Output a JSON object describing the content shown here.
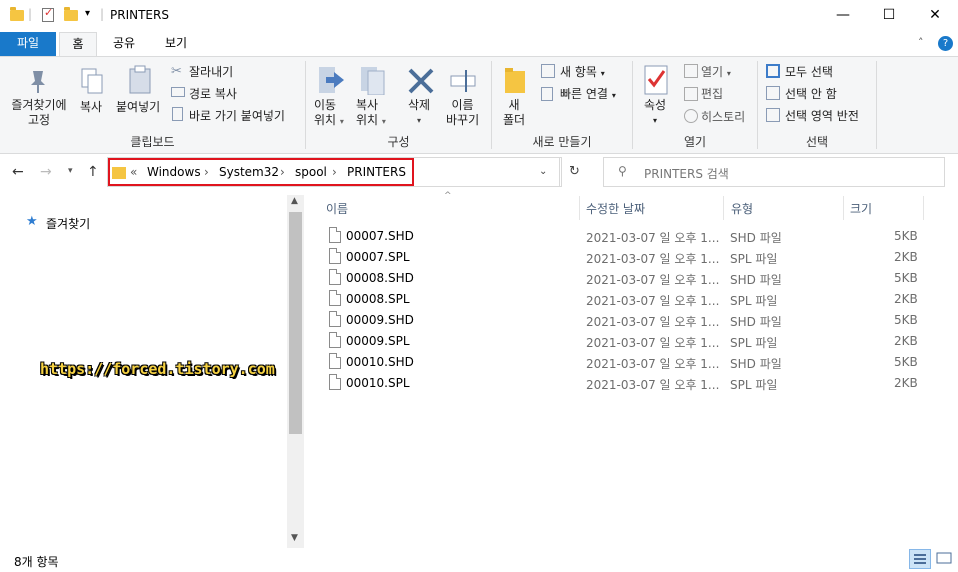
{
  "window": {
    "title": "PRINTERS",
    "qa_sep": "|",
    "qa_dropdown": "▾",
    "min": "—",
    "max": "☐",
    "close": "✕"
  },
  "tabs": [
    "파일",
    "홈",
    "공유",
    "보기"
  ],
  "ribbon": {
    "pin": [
      "즐겨찾기에",
      "고정"
    ],
    "copy": "복사",
    "paste": "붙여넣기",
    "cut": "잘라내기",
    "copy_path": "경로 복사",
    "paste_shortcut": "바로 가기 붙여넣기",
    "group_clipboard": "클립보드",
    "move_to": [
      "이동",
      "위치"
    ],
    "copy_to": [
      "복사",
      "위치"
    ],
    "delete": "삭제",
    "rename": [
      "이름",
      "바꾸기"
    ],
    "group_organize": "구성",
    "new_folder": [
      "새",
      "폴더"
    ],
    "new_item": "새 항목",
    "easy_access": "빠른 연결",
    "group_new": "새로 만들기",
    "properties": "속성",
    "open": "열기",
    "edit": "편집",
    "history": "히스토리",
    "group_open": "열기",
    "select_all": "모두 선택",
    "select_none": "선택 안 함",
    "invert_select": "선택 영역 반전",
    "group_select": "선택"
  },
  "address": {
    "prefix": "«",
    "crumbs": [
      "Windows",
      "System32",
      "spool",
      "PRINTERS"
    ],
    "sep": "›",
    "search_placeholder": "PRINTERS 검색"
  },
  "navpane": {
    "quick_access": "즐겨찾기"
  },
  "columns": [
    "이름",
    "수정한 날짜",
    "유형",
    "크기"
  ],
  "files": [
    {
      "name": "00007.SHD",
      "date": "2021-03-07 일 오후 1...",
      "type": "SHD 파일",
      "size": "5KB"
    },
    {
      "name": "00007.SPL",
      "date": "2021-03-07 일 오후 1...",
      "type": "SPL 파일",
      "size": "2KB"
    },
    {
      "name": "00008.SHD",
      "date": "2021-03-07 일 오후 1...",
      "type": "SHD 파일",
      "size": "5KB"
    },
    {
      "name": "00008.SPL",
      "date": "2021-03-07 일 오후 1...",
      "type": "SPL 파일",
      "size": "2KB"
    },
    {
      "name": "00009.SHD",
      "date": "2021-03-07 일 오후 1...",
      "type": "SHD 파일",
      "size": "5KB"
    },
    {
      "name": "00009.SPL",
      "date": "2021-03-07 일 오후 1...",
      "type": "SPL 파일",
      "size": "2KB"
    },
    {
      "name": "00010.SHD",
      "date": "2021-03-07 일 오후 1...",
      "type": "SHD 파일",
      "size": "5KB"
    },
    {
      "name": "00010.SPL",
      "date": "2021-03-07 일 오후 1...",
      "type": "SPL 파일",
      "size": "2KB"
    }
  ],
  "watermark": "https://forced.tistory.com",
  "status": "8개 항목",
  "colors": {
    "accent": "#1979ca",
    "highlight_border": "#e0141e"
  }
}
